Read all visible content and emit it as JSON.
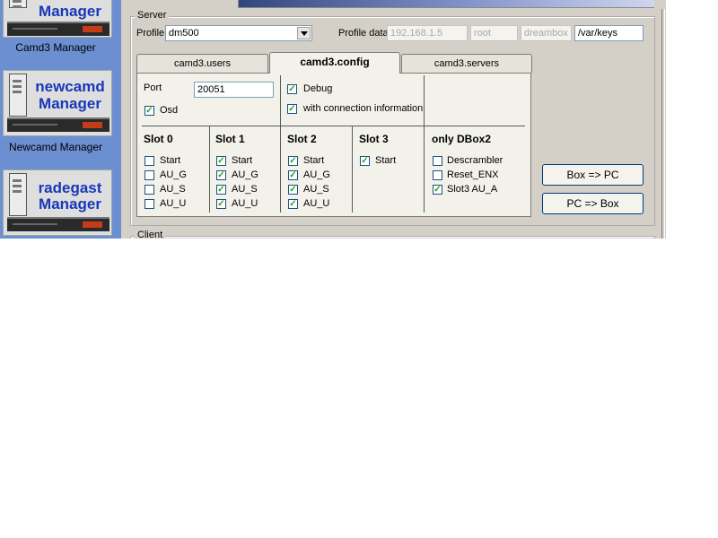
{
  "sidebar": {
    "tiles": [
      {
        "brand_line1": "Manager",
        "caption": "Camd3 Manager"
      },
      {
        "brand_line1": "newcamd",
        "brand_line2": "Manager",
        "caption": "Newcamd Manager"
      },
      {
        "brand_line1": "radegast",
        "brand_line2": "Manager",
        "caption": ""
      }
    ]
  },
  "server": {
    "title": "Server",
    "profile_label": "Profile",
    "profile_value": "dm500",
    "profile_data_label": "Profile data",
    "ip": "192.168.1.5",
    "user": "root",
    "password": "dreambox",
    "keys_path": "/var/keys"
  },
  "tabs": [
    {
      "label": "camd3.users",
      "active": false
    },
    {
      "label": "camd3.config",
      "active": true
    },
    {
      "label": "camd3.servers",
      "active": false
    }
  ],
  "config": {
    "port_label": "Port",
    "port_value": "20051",
    "osd_label": "Osd",
    "osd_checked": true,
    "debug_label": "Debug",
    "debug_checked": true,
    "conn_info_label": "with connection information",
    "conn_info_checked": true,
    "slots": [
      {
        "title": "Slot 0",
        "items": [
          {
            "label": "Start",
            "checked": false
          },
          {
            "label": "AU_G",
            "checked": false
          },
          {
            "label": "AU_S",
            "checked": false
          },
          {
            "label": "AU_U",
            "checked": false
          }
        ]
      },
      {
        "title": "Slot 1",
        "items": [
          {
            "label": "Start",
            "checked": true
          },
          {
            "label": "AU_G",
            "checked": true
          },
          {
            "label": "AU_S",
            "checked": true
          },
          {
            "label": "AU_U",
            "checked": true
          }
        ]
      },
      {
        "title": "Slot 2",
        "items": [
          {
            "label": "Start",
            "checked": true
          },
          {
            "label": "AU_G",
            "checked": true
          },
          {
            "label": "AU_S",
            "checked": true
          },
          {
            "label": "AU_U",
            "checked": true
          }
        ]
      },
      {
        "title": "Slot 3",
        "items": [
          {
            "label": "Start",
            "checked": true
          }
        ]
      }
    ],
    "dbox2": {
      "title": "only DBox2",
      "items": [
        {
          "label": "Descrambler",
          "checked": false
        },
        {
          "label": "Reset_ENX",
          "checked": false
        },
        {
          "label": "Slot3 AU_A",
          "checked": true
        }
      ]
    }
  },
  "buttons": {
    "box_to_pc": "Box => PC",
    "pc_to_box": "PC => Box"
  },
  "client": {
    "title": "Client"
  },
  "check_glyph": "✓"
}
